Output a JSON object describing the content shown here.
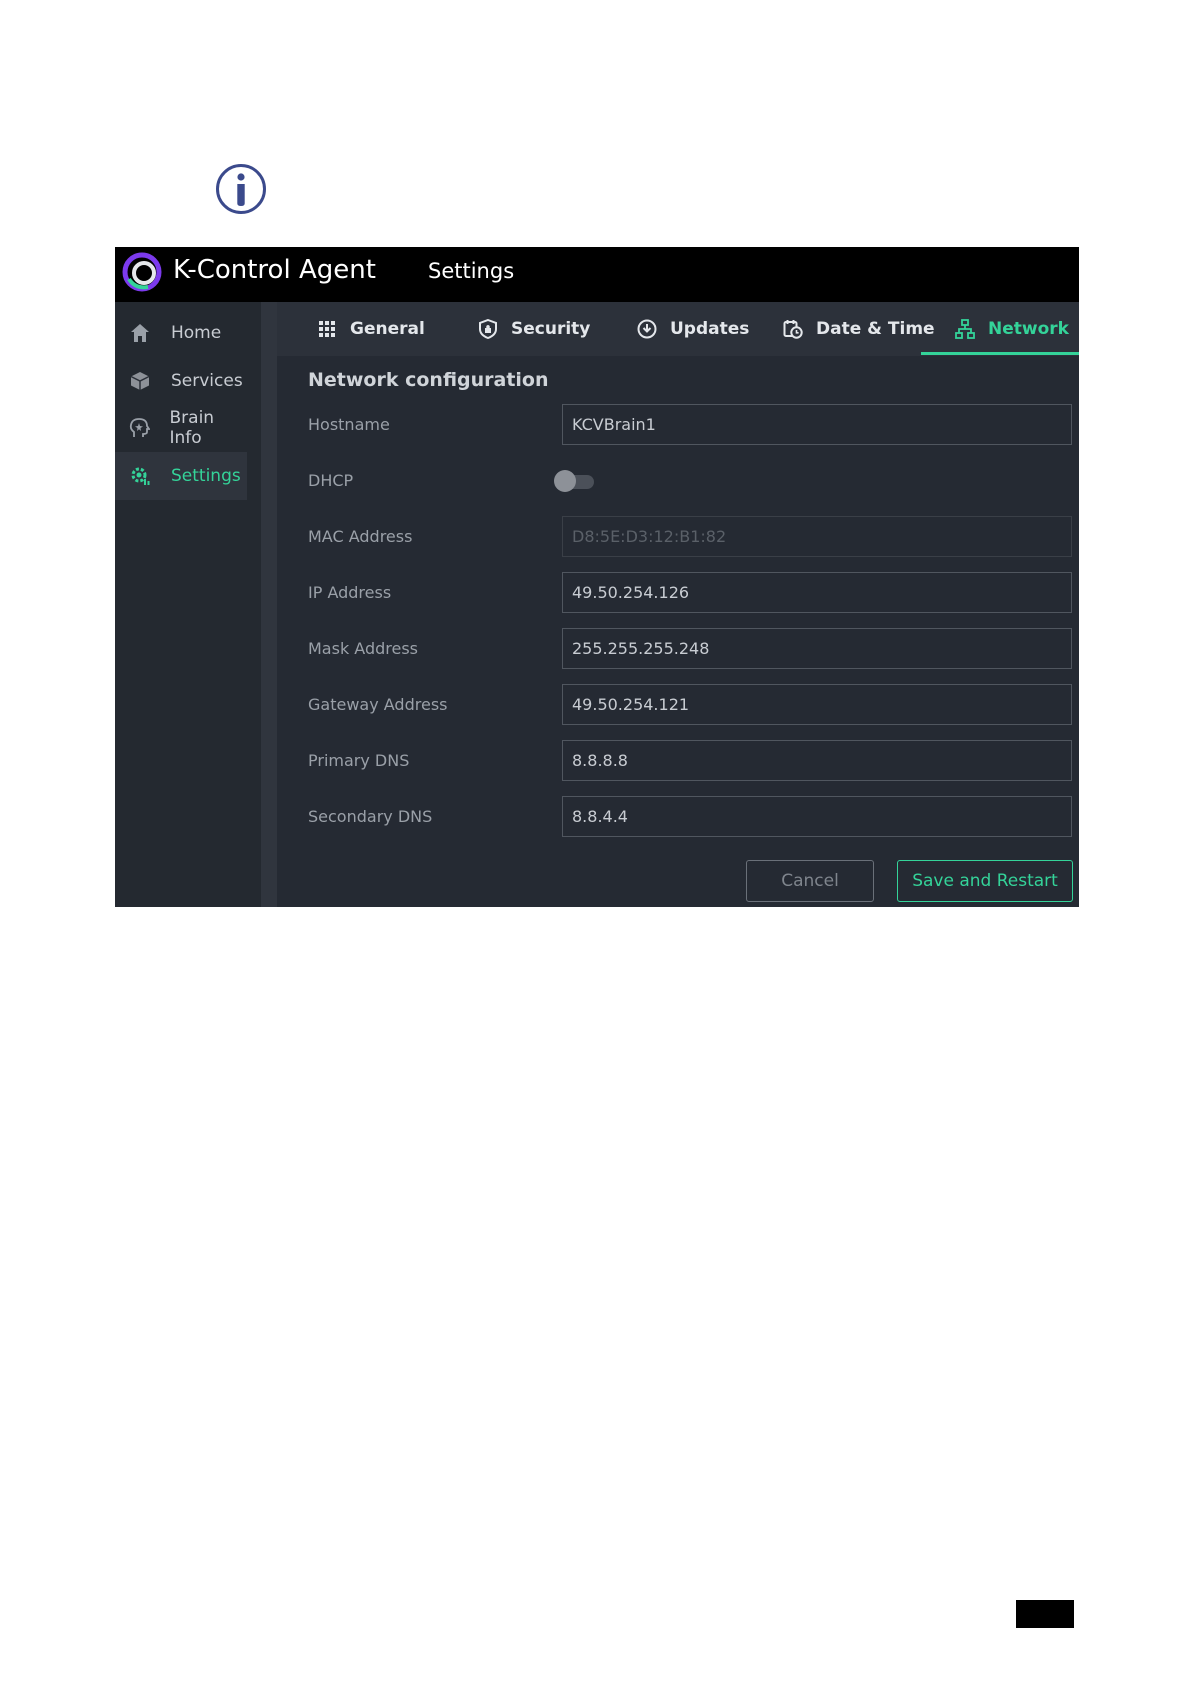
{
  "header": {
    "app_title": "K-Control Agent",
    "section_title": "Settings"
  },
  "sidebar": {
    "items": [
      {
        "label": "Home",
        "icon": "home-icon",
        "active": false
      },
      {
        "label": "Services",
        "icon": "box-icon",
        "active": false
      },
      {
        "label": "Brain Info",
        "icon": "brain-info-icon",
        "active": false
      },
      {
        "label": "Settings",
        "icon": "settings-gear-icon",
        "active": true
      }
    ]
  },
  "tabs": [
    {
      "label": "General",
      "icon": "grid-icon",
      "active": false
    },
    {
      "label": "Security",
      "icon": "shield-icon",
      "active": false
    },
    {
      "label": "Updates",
      "icon": "download-circle-icon",
      "active": false
    },
    {
      "label": "Date & Time",
      "icon": "calendar-clock-icon",
      "active": false
    },
    {
      "label": "Network",
      "icon": "network-icon",
      "active": true
    }
  ],
  "form": {
    "title": "Network configuration",
    "hostname": {
      "label": "Hostname",
      "value": "KCVBrain1"
    },
    "dhcp": {
      "label": "DHCP",
      "enabled": false
    },
    "mac": {
      "label": "MAC Address",
      "value": "D8:5E:D3:12:B1:82",
      "disabled": true
    },
    "ip": {
      "label": "IP Address",
      "value": "49.50.254.126"
    },
    "mask": {
      "label": "Mask Address",
      "value": "255.255.255.248"
    },
    "gateway": {
      "label": "Gateway Address",
      "value": "49.50.254.121"
    },
    "primary_dns": {
      "label": "Primary DNS",
      "value": "8.8.8.8"
    },
    "secondary_dns": {
      "label": "Secondary DNS",
      "value": "8.8.4.4"
    }
  },
  "actions": {
    "cancel_label": "Cancel",
    "save_label": "Save and Restart"
  },
  "colors": {
    "accent": "#34d399",
    "background": "#252a33",
    "topbar": "#000000",
    "logo_purple": "#7c3aed"
  }
}
